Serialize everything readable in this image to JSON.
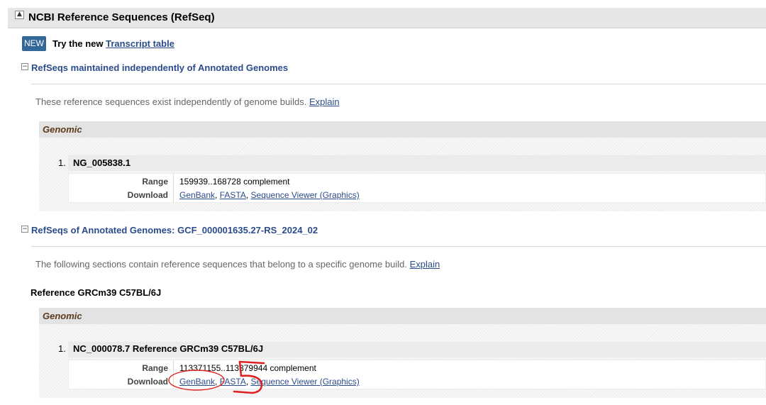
{
  "section": {
    "toggle": "▲",
    "title": "NCBI Reference Sequences (RefSeq)"
  },
  "banner": {
    "badge": "NEW",
    "text": "Try the new ",
    "link": "Transcript table"
  },
  "independent": {
    "toggle": "−",
    "title": "RefSeqs maintained independently of Annotated Genomes",
    "description": "These reference sequences exist independently of genome builds.",
    "explain": "Explain",
    "group": "Genomic",
    "record": {
      "number": "1.",
      "accession": "NG_005838.1",
      "range_label": "Range",
      "range_value": "159939..168728 complement",
      "download_label": "Download",
      "links": [
        "GenBank",
        "FASTA",
        "Sequence Viewer (Graphics)"
      ]
    }
  },
  "annotated": {
    "toggle": "−",
    "title": "RefSeqs of Annotated Genomes: GCF_000001635.27-RS_2024_02",
    "description": "The following sections contain reference sequences that belong to a specific genome build.",
    "explain": "Explain",
    "reference": "Reference GRCm39 C57BL/6J",
    "group": "Genomic",
    "record": {
      "number": "1.",
      "accession": "NC_000078.7 Reference GRCm39 C57BL/6J",
      "range_label": "Range",
      "range_value": "113371155..113379944 complement",
      "download_label": "Download",
      "links": [
        "GenBank",
        "FASTA",
        "Sequence Viewer (Graphics)"
      ]
    }
  },
  "annotation_color": "#e02020"
}
